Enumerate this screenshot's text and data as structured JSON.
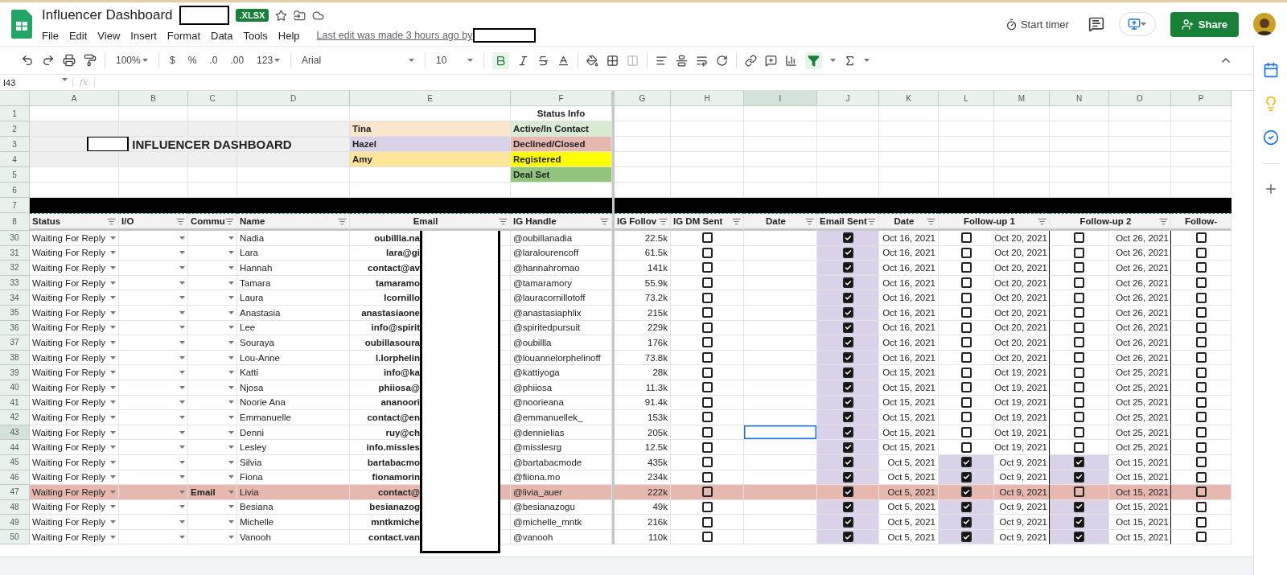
{
  "document": {
    "title": "Influencer Dashboard",
    "badge": ".XLSX"
  },
  "menu": [
    "File",
    "Edit",
    "View",
    "Insert",
    "Format",
    "Data",
    "Tools",
    "Help"
  ],
  "last_edit": "Last edit was made 3 hours ago by",
  "header_actions": {
    "timer": "Start timer",
    "share": "Share"
  },
  "toolbar": {
    "zoom": "100%",
    "currency": "$",
    "percent": "%",
    "decrease_decimals": ".0",
    "increase_decimals": ".00",
    "more_formats": "123",
    "font": "Arial",
    "font_size": "10",
    "bold_on": true,
    "filter_on": true
  },
  "formula_bar": {
    "cell_ref": "I43",
    "fx": "fx"
  },
  "columns": [
    {
      "letter": "A",
      "selected": false
    },
    {
      "letter": "B",
      "selected": false
    },
    {
      "letter": "C",
      "selected": false
    },
    {
      "letter": "D",
      "selected": false
    },
    {
      "letter": "E",
      "selected": false
    },
    {
      "letter": "F",
      "selected": false
    },
    {
      "letter": "G",
      "selected": false
    },
    {
      "letter": "H",
      "selected": false
    },
    {
      "letter": "I",
      "selected": true
    },
    {
      "letter": "J",
      "selected": false
    },
    {
      "letter": "K",
      "selected": false
    },
    {
      "letter": "L",
      "selected": false
    },
    {
      "letter": "M",
      "selected": false
    },
    {
      "letter": "N",
      "selected": false
    },
    {
      "letter": "O",
      "selected": false
    },
    {
      "letter": "P",
      "selected": false
    }
  ],
  "top_row_numbers": [
    "1",
    "2",
    "3",
    "4",
    "5",
    "6",
    "7",
    "8"
  ],
  "dashboard_title": "INFLUENCER DASHBOARD",
  "status_info_title": "Status Info",
  "people": [
    {
      "name": "Tina",
      "color": "#fce5cd"
    },
    {
      "name": "Hazel",
      "color": "#d9d2e9"
    },
    {
      "name": "Amy",
      "color": "#ffe599"
    }
  ],
  "statuses": [
    {
      "label": "Active/In Contact",
      "color": "#d9ead3"
    },
    {
      "label": "Declined/Closed",
      "color": "#e6b8af"
    },
    {
      "label": "Registered",
      "color": "#ffff00"
    },
    {
      "label": "Deal Set",
      "color": "#93c47d"
    }
  ],
  "headers": [
    {
      "label": "Status",
      "filter": true
    },
    {
      "label": "I/O",
      "filter": true
    },
    {
      "label": "Commu",
      "filter": true
    },
    {
      "label": "Name",
      "filter": true
    },
    {
      "label": "Email",
      "filter": true
    },
    {
      "label": "IG Handle",
      "filter": true
    },
    {
      "label": "IG Follov",
      "filter": true
    },
    {
      "label": "IG DM Sent",
      "filter": true
    },
    {
      "label": "Date",
      "filter": true
    },
    {
      "label": "Email Sent",
      "filter": true
    },
    {
      "label": "Date",
      "filter": true
    },
    {
      "label": "Follow-up 1",
      "filter": true
    },
    {
      "label": "Follow-up 2",
      "filter": true
    },
    {
      "label": "Follow-",
      "filter": false
    }
  ],
  "rows": [
    {
      "number": "30",
      "status": "Waiting For Reply",
      "name": "Nadia",
      "email": "oubillla.na",
      "handle": "@oubillanadia",
      "followers": "22.5k",
      "dm_sent": false,
      "email_sent": true,
      "sent_date": "Oct 16, 2021",
      "fu1": {
        "checked": false,
        "date": "Oct 20, 2021"
      },
      "fu2": {
        "checked": false,
        "date": "Oct 26, 2021"
      },
      "fu3": false,
      "highlighted": false,
      "selected": false
    },
    {
      "number": "31",
      "status": "Waiting For Reply",
      "name": "Lara",
      "email": "lara@gi",
      "handle": "@laralourencoff",
      "followers": "61.5k",
      "dm_sent": false,
      "email_sent": true,
      "sent_date": "Oct 16, 2021",
      "fu1": {
        "checked": false,
        "date": "Oct 20, 2021"
      },
      "fu2": {
        "checked": false,
        "date": "Oct 26, 2021"
      },
      "fu3": false,
      "highlighted": false,
      "selected": false
    },
    {
      "number": "32",
      "status": "Waiting For Reply",
      "name": "Hannah",
      "email": "contact@av",
      "handle": "@hannahromao",
      "followers": "141k",
      "dm_sent": false,
      "email_sent": true,
      "sent_date": "Oct 16, 2021",
      "fu1": {
        "checked": false,
        "date": "Oct 20, 2021"
      },
      "fu2": {
        "checked": false,
        "date": "Oct 26, 2021"
      },
      "fu3": false,
      "highlighted": false,
      "selected": false
    },
    {
      "number": "33",
      "status": "Waiting For Reply",
      "name": "Tamara",
      "email": "tamaramo",
      "handle": "@tamaramory",
      "followers": "55.9k",
      "dm_sent": false,
      "email_sent": true,
      "sent_date": "Oct 16, 2021",
      "fu1": {
        "checked": false,
        "date": "Oct 20, 2021"
      },
      "fu2": {
        "checked": false,
        "date": "Oct 26, 2021"
      },
      "fu3": false,
      "highlighted": false,
      "selected": false
    },
    {
      "number": "34",
      "status": "Waiting For Reply",
      "name": "Laura",
      "email": "lcornillo",
      "handle": "@lauracornillotoff",
      "followers": "73.2k",
      "dm_sent": false,
      "email_sent": true,
      "sent_date": "Oct 16, 2021",
      "fu1": {
        "checked": false,
        "date": "Oct 20, 2021"
      },
      "fu2": {
        "checked": false,
        "date": "Oct 26, 2021"
      },
      "fu3": false,
      "highlighted": false,
      "selected": false
    },
    {
      "number": "35",
      "status": "Waiting For Reply",
      "name": "Anastasia",
      "email": "anastasiaone",
      "handle": "@anastasiaphlix",
      "followers": "215k",
      "dm_sent": false,
      "email_sent": true,
      "sent_date": "Oct 16, 2021",
      "fu1": {
        "checked": false,
        "date": "Oct 20, 2021"
      },
      "fu2": {
        "checked": false,
        "date": "Oct 26, 2021"
      },
      "fu3": false,
      "highlighted": false,
      "selected": false
    },
    {
      "number": "36",
      "status": "Waiting For Reply",
      "name": "Lee",
      "email": "info@spirit",
      "handle": "@spiritedpursuit",
      "followers": "229k",
      "dm_sent": false,
      "email_sent": true,
      "sent_date": "Oct 16, 2021",
      "fu1": {
        "checked": false,
        "date": "Oct 20, 2021"
      },
      "fu2": {
        "checked": false,
        "date": "Oct 26, 2021"
      },
      "fu3": false,
      "highlighted": false,
      "selected": false
    },
    {
      "number": "37",
      "status": "Waiting For Reply",
      "name": "Souraya",
      "email": "oubillasoura",
      "handle": "@oubillla",
      "followers": "176k",
      "dm_sent": false,
      "email_sent": true,
      "sent_date": "Oct 16, 2021",
      "fu1": {
        "checked": false,
        "date": "Oct 20, 2021"
      },
      "fu2": {
        "checked": false,
        "date": "Oct 26, 2021"
      },
      "fu3": false,
      "highlighted": false,
      "selected": false
    },
    {
      "number": "38",
      "status": "Waiting For Reply",
      "name": "Lou-Anne",
      "email": "l.lorphelin",
      "handle": "@louannelorphelinoff",
      "followers": "73.8k",
      "dm_sent": false,
      "email_sent": true,
      "sent_date": "Oct 16, 2021",
      "fu1": {
        "checked": false,
        "date": "Oct 20, 2021"
      },
      "fu2": {
        "checked": false,
        "date": "Oct 26, 2021"
      },
      "fu3": false,
      "highlighted": false,
      "selected": false
    },
    {
      "number": "39",
      "status": "Waiting For Reply",
      "name": "Katti",
      "email": "info@ka",
      "handle": "@kattiyoga",
      "followers": "28k",
      "dm_sent": false,
      "email_sent": true,
      "sent_date": "Oct 15, 2021",
      "fu1": {
        "checked": false,
        "date": "Oct 19, 2021"
      },
      "fu2": {
        "checked": false,
        "date": "Oct 25, 2021"
      },
      "fu3": false,
      "highlighted": false,
      "selected": false
    },
    {
      "number": "40",
      "status": "Waiting For Reply",
      "name": "Njosa",
      "email": "phiiosa@",
      "handle": "@phiiosa",
      "followers": "11.3k",
      "dm_sent": false,
      "email_sent": true,
      "sent_date": "Oct 15, 2021",
      "fu1": {
        "checked": false,
        "date": "Oct 19, 2021"
      },
      "fu2": {
        "checked": false,
        "date": "Oct 25, 2021"
      },
      "fu3": false,
      "highlighted": false,
      "selected": false
    },
    {
      "number": "41",
      "status": "Waiting For Reply",
      "name": "Noorie Ana",
      "email": "ananoori",
      "handle": "@noorieana",
      "followers": "91.4k",
      "dm_sent": false,
      "email_sent": true,
      "sent_date": "Oct 15, 2021",
      "fu1": {
        "checked": false,
        "date": "Oct 19, 2021"
      },
      "fu2": {
        "checked": false,
        "date": "Oct 25, 2021"
      },
      "fu3": false,
      "highlighted": false,
      "selected": false
    },
    {
      "number": "42",
      "status": "Waiting For Reply",
      "name": "Emmanuelle",
      "email": "contact@en",
      "handle": "@emmanuellek_",
      "followers": "153k",
      "dm_sent": false,
      "email_sent": true,
      "sent_date": "Oct 15, 2021",
      "fu1": {
        "checked": false,
        "date": "Oct 19, 2021"
      },
      "fu2": {
        "checked": false,
        "date": "Oct 25, 2021"
      },
      "fu3": false,
      "highlighted": false,
      "selected": false
    },
    {
      "number": "43",
      "status": "Waiting For Reply",
      "name": "Denni",
      "email": "ruy@ch",
      "handle": "@dennielias",
      "followers": "205k",
      "dm_sent": false,
      "email_sent": true,
      "sent_date": "Oct 15, 2021",
      "fu1": {
        "checked": false,
        "date": "Oct 19, 2021"
      },
      "fu2": {
        "checked": false,
        "date": "Oct 25, 2021"
      },
      "fu3": false,
      "highlighted": false,
      "selected": true
    },
    {
      "number": "44",
      "status": "Waiting For Reply",
      "name": "Lesley",
      "email": "info.missles",
      "handle": "@misslesrg",
      "followers": "12.5k",
      "dm_sent": false,
      "email_sent": true,
      "sent_date": "Oct 15, 2021",
      "fu1": {
        "checked": false,
        "date": "Oct 19, 2021"
      },
      "fu2": {
        "checked": false,
        "date": "Oct 25, 2021"
      },
      "fu3": false,
      "highlighted": false,
      "selected": false
    },
    {
      "number": "45",
      "status": "Waiting For Reply",
      "name": "Silvia",
      "email": "bartabacmo",
      "handle": "@bartabacmode",
      "followers": "435k",
      "dm_sent": false,
      "email_sent": true,
      "sent_date": "Oct 5, 2021",
      "fu1": {
        "checked": true,
        "date": "Oct 9, 2021"
      },
      "fu2": {
        "checked": true,
        "date": "Oct 15, 2021"
      },
      "fu3": false,
      "highlighted": false,
      "selected": false
    },
    {
      "number": "46",
      "status": "Waiting For Reply",
      "name": "Fiona",
      "email": "fionamorin",
      "handle": "@fiiona.mo",
      "followers": "234k",
      "dm_sent": false,
      "email_sent": true,
      "sent_date": "Oct 5, 2021",
      "fu1": {
        "checked": true,
        "date": "Oct 9, 2021"
      },
      "fu2": {
        "checked": true,
        "date": "Oct 15, 2021"
      },
      "fu3": false,
      "highlighted": false,
      "selected": false
    },
    {
      "number": "47",
      "status": "Waiting For Reply",
      "comm": "Email",
      "name": "Livia",
      "email": "contact@",
      "handle": "@livia_auer",
      "followers": "222k",
      "dm_sent": false,
      "email_sent": true,
      "sent_date": "Oct 5, 2021",
      "fu1": {
        "checked": true,
        "date": "Oct 9, 2021"
      },
      "fu2": {
        "checked": false,
        "date": "Oct 15, 2021"
      },
      "fu3": false,
      "highlighted": true,
      "selected": false
    },
    {
      "number": "48",
      "status": "Waiting For Reply",
      "name": "Besiana",
      "email": "besianazog",
      "handle": "@besianazogu",
      "followers": "49k",
      "dm_sent": false,
      "email_sent": true,
      "sent_date": "Oct 5, 2021",
      "fu1": {
        "checked": true,
        "date": "Oct 9, 2021"
      },
      "fu2": {
        "checked": true,
        "date": "Oct 15, 2021"
      },
      "fu3": false,
      "highlighted": false,
      "selected": false
    },
    {
      "number": "49",
      "status": "Waiting For Reply",
      "name": "Michelle",
      "email": "mntkmiche",
      "handle": "@michelle_mntk",
      "followers": "216k",
      "dm_sent": false,
      "email_sent": true,
      "sent_date": "Oct 5, 2021",
      "fu1": {
        "checked": true,
        "date": "Oct 9, 2021"
      },
      "fu2": {
        "checked": true,
        "date": "Oct 15, 2021"
      },
      "fu3": false,
      "highlighted": false,
      "selected": false
    },
    {
      "number": "50",
      "status": "Waiting For Reply",
      "name": "Vanooh",
      "email": "contact.van",
      "handle": "@vanooh",
      "followers": "110k",
      "dm_sent": false,
      "email_sent": true,
      "sent_date": "Oct 5, 2021",
      "fu1": {
        "checked": true,
        "date": "Oct 9, 2021"
      },
      "fu2": {
        "checked": true,
        "date": "Oct 15, 2021"
      },
      "fu3": false,
      "highlighted": false,
      "selected": false
    }
  ]
}
